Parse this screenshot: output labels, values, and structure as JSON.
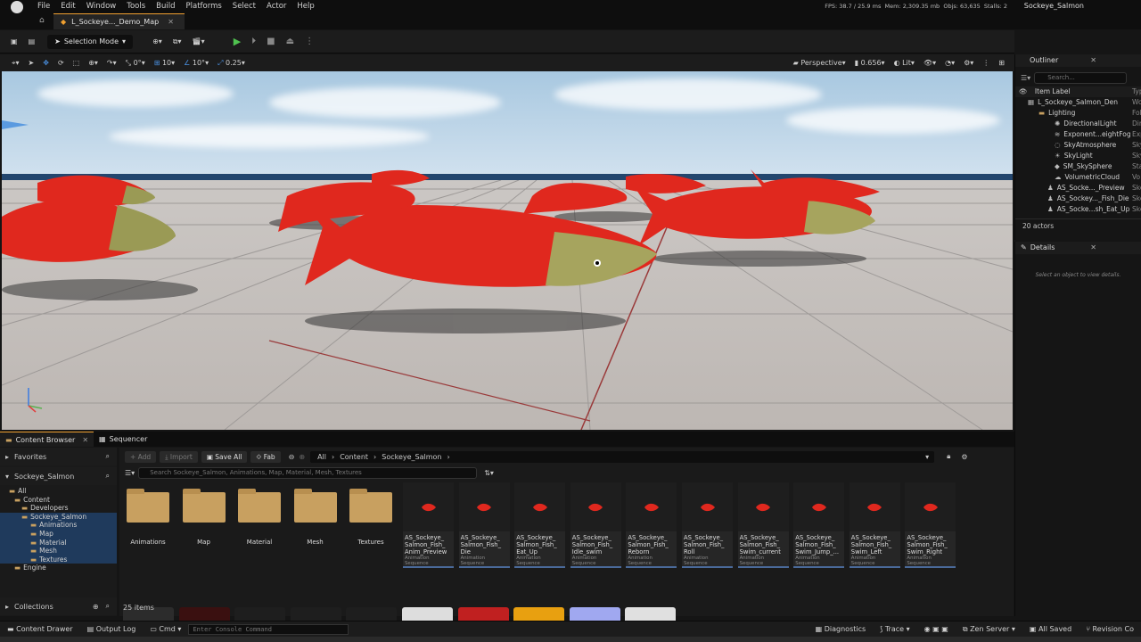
{
  "menu": [
    "File",
    "Edit",
    "Window",
    "Tools",
    "Build",
    "Platforms",
    "Select",
    "Actor",
    "Help"
  ],
  "doc_tab": "L_Sockeye..._Demo_Map",
  "stats": {
    "fps_label": "FPS:",
    "fps": "38.7",
    "ms": "/ 25.9 ms",
    "mem_label": "Mem:",
    "mem": "2,309.35 mb",
    "objs_label": "Objs:",
    "objs": "63,635",
    "stalls_label": "Stalls:",
    "stalls": "2"
  },
  "project_name": "Sockeye_Salmon",
  "toolbar": {
    "selection_mode": "Selection Mode"
  },
  "viewport_toolbar": {
    "rot_snap": "0°",
    "grid": "10",
    "angle": "10°",
    "scale": "0.25",
    "view": "Perspective",
    "fov": "0.656",
    "lit": "Lit"
  },
  "outliner": {
    "title": "Outliner",
    "search_placeholder": "Search...",
    "col_label": "Item Label",
    "col_type": "Type",
    "rows": [
      {
        "label": "L_Sockeye_Salmon_Den",
        "type": "Wo",
        "indent": 14,
        "icon": "map-icon"
      },
      {
        "label": "Lighting",
        "type": "Fol",
        "indent": 26,
        "icon": "folder-icon"
      },
      {
        "label": "DirectionalLight",
        "type": "Dir",
        "indent": 44,
        "icon": "sun-icon"
      },
      {
        "label": "Exponent...eightFog",
        "type": "Exp",
        "indent": 44,
        "icon": "fog-icon"
      },
      {
        "label": "SkyAtmosphere",
        "type": "Sky",
        "indent": 44,
        "icon": "sky-icon"
      },
      {
        "label": "SkyLight",
        "type": "Sky",
        "indent": 44,
        "icon": "skylight-icon"
      },
      {
        "label": "SM_SkySphere",
        "type": "Sta",
        "indent": 44,
        "icon": "mesh-icon"
      },
      {
        "label": "VolumetricCloud",
        "type": "Vo",
        "indent": 44,
        "icon": "cloud-icon"
      },
      {
        "label": "AS_Socke..._Preview",
        "type": "Ske",
        "indent": 36,
        "icon": "skeleton-icon"
      },
      {
        "label": "AS_Sockey..._Fish_Die",
        "type": "Ske",
        "indent": 36,
        "icon": "skeleton-icon"
      },
      {
        "label": "AS_Socke...sh_Eat_Up",
        "type": "Ske",
        "indent": 36,
        "icon": "skeleton-icon"
      }
    ],
    "count": "20 actors"
  },
  "details": {
    "title": "Details",
    "empty": "Select an object to view details."
  },
  "content_browser": {
    "tab": "Content Browser",
    "tab2": "Sequencer",
    "add": "Add",
    "import": "Import",
    "save_all": "Save All",
    "fab": "Fab",
    "path": [
      "All",
      "Content",
      "Sockeye_Salmon"
    ],
    "favorites": "Favorites",
    "root": "Sockeye_Salmon",
    "tree": [
      {
        "label": "All",
        "indent": 10
      },
      {
        "label": "Content",
        "indent": 16
      },
      {
        "label": "Developers",
        "indent": 24
      },
      {
        "label": "Sockeye_Salmon",
        "indent": 24
      },
      {
        "label": "Animations",
        "indent": 34
      },
      {
        "label": "Map",
        "indent": 34
      },
      {
        "label": "Material",
        "indent": 34
      },
      {
        "label": "Mesh",
        "indent": 34
      },
      {
        "label": "Textures",
        "indent": 34
      },
      {
        "label": "Engine",
        "indent": 16
      }
    ],
    "collections": "Collections",
    "search_placeholder": "Search Sockeye_Salmon, Animations, Map, Material, Mesh, Textures",
    "folders": [
      "Animations",
      "Map",
      "Material",
      "Mesh",
      "Textures"
    ],
    "assets": [
      {
        "l1": "AS_Sockeye_",
        "l2": "Salmon_Fish_",
        "l3": "Anim_Preview"
      },
      {
        "l1": "AS_Sockeye_",
        "l2": "Salmon_Fish_",
        "l3": "Die"
      },
      {
        "l1": "AS_Sockeye_",
        "l2": "Salmon_Fish_",
        "l3": "Eat_Up"
      },
      {
        "l1": "AS_Sockeye_",
        "l2": "Salmon_Fish_",
        "l3": "Idle_swim"
      },
      {
        "l1": "AS_Sockeye_",
        "l2": "Salmon_Fish_",
        "l3": "Reborn"
      },
      {
        "l1": "AS_Sockeye_",
        "l2": "Salmon_Fish_",
        "l3": "Roll"
      },
      {
        "l1": "AS_Sockeye_",
        "l2": "Salmon_Fish_",
        "l3": "Swim_current"
      },
      {
        "l1": "AS_Sockeye_",
        "l2": "Salmon_Fish_",
        "l3": "Swim_Jump_..."
      },
      {
        "l1": "AS_Sockeye_",
        "l2": "Salmon_Fish_",
        "l3": "Swim_Left"
      },
      {
        "l1": "AS_Sockeye_",
        "l2": "Salmon_Fish_",
        "l3": "Swim_Right"
      }
    ],
    "asset_kind": "Animation Sequence",
    "items": "25 items"
  },
  "statusbar": {
    "drawer": "Content Drawer",
    "output": "Output Log",
    "cmd": "Cmd",
    "console_placeholder": "Enter Console Command",
    "diagnostics": "Diagnostics",
    "trace": "Trace",
    "zen": "Zen Server",
    "saved": "All Saved",
    "revision": "Revision Co"
  },
  "colors": {
    "accent": "#f0a030",
    "play": "#4fc24f",
    "salmon": "#e0281e",
    "selection": "#1f3a5c"
  }
}
